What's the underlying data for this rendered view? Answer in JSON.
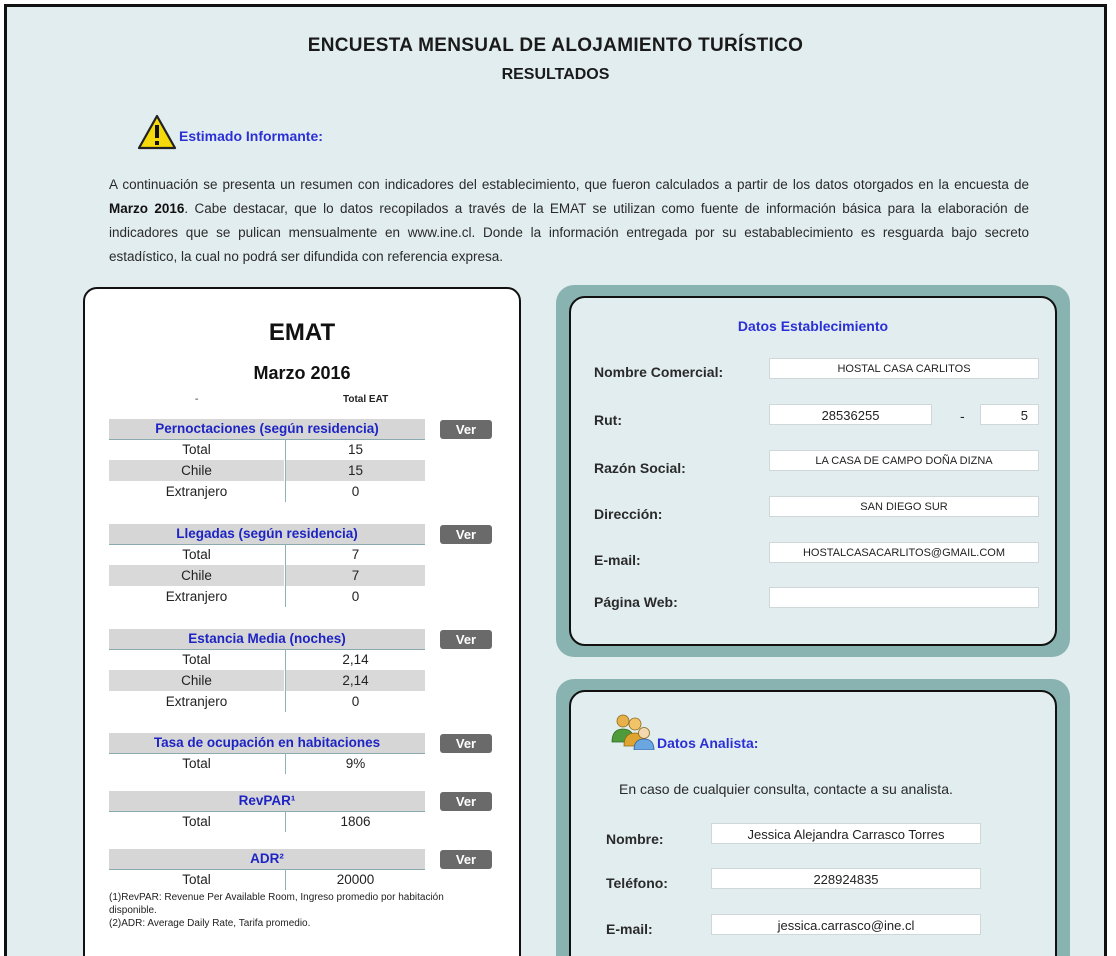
{
  "header": {
    "title": "ENCUESTA MENSUAL DE ALOJAMIENTO TURÍSTICO",
    "subtitle": "RESULTADOS"
  },
  "notice": {
    "icon": "warning-icon",
    "label": "Estimado Informante:",
    "text_before": "A continuación se presenta un resumen con indicadores del establecimiento, que fueron calculados a partir de los datos otorgados en la encuesta de ",
    "text_bold": "Marzo 2016",
    "text_after": ". Cabe destacar, que lo datos recopilados a través de la EMAT se utilizan como fuente de información básica para la elaboración de indicadores que se pulican mensualmente en www.ine.cl. Donde la información entregada por su estabablecimiento es resguarda bajo secreto estadístico, la cual no podrá ser difundida con referencia expresa."
  },
  "emat": {
    "title": "EMAT",
    "period": "Marzo 2016",
    "col_label": "-",
    "col_total": "Total EAT",
    "ver_label": "Ver",
    "sections": [
      {
        "title": "Pernoctaciones (según residencia)",
        "rows": [
          {
            "label": "Total",
            "value": "15"
          },
          {
            "label": "Chile",
            "value": "15"
          },
          {
            "label": "Extranjero",
            "value": "0"
          }
        ]
      },
      {
        "title": "Llegadas (según residencia)",
        "rows": [
          {
            "label": "Total",
            "value": "7"
          },
          {
            "label": "Chile",
            "value": "7"
          },
          {
            "label": "Extranjero",
            "value": "0"
          }
        ]
      },
      {
        "title": "Estancia Media (noches)",
        "rows": [
          {
            "label": "Total",
            "value": "2,14"
          },
          {
            "label": "Chile",
            "value": "2,14"
          },
          {
            "label": "Extranjero",
            "value": "0"
          }
        ]
      },
      {
        "title": "Tasa de ocupación en habitaciones",
        "rows": [
          {
            "label": "Total",
            "value": "9%"
          }
        ]
      },
      {
        "title": "RevPAR¹",
        "rows": [
          {
            "label": "Total",
            "value": "1806"
          }
        ]
      },
      {
        "title": "ADR²",
        "rows": [
          {
            "label": "Total",
            "value": "20000"
          }
        ]
      }
    ],
    "footnote1": "(1)RevPAR: Revenue Per Available Room, Ingreso promedio por habitación disponible.",
    "footnote2": "(2)ADR: Average Daily Rate, Tarifa promedio."
  },
  "establecimiento": {
    "title": "Datos Establecimiento",
    "nombre_label": "Nombre Comercial:",
    "nombre_value": "HOSTAL CASA CARLITOS",
    "rut_label": "Rut:",
    "rut_value": "28536255",
    "rut_sep": "-",
    "rut_dv": "5",
    "razon_label": "Razón Social:",
    "razon_value": "LA CASA DE CAMPO DOÑA DIZNA",
    "direccion_label": "Dirección:",
    "direccion_value": "SAN DIEGO SUR",
    "email_label": "E-mail:",
    "email_value": "HOSTALCASACARLITOS@GMAIL.COM",
    "web_label": "Página Web:",
    "web_value": ""
  },
  "analista": {
    "icon": "users-icon",
    "title": "Datos Analista:",
    "note": "En caso de cualquier consulta, contacte a su analista.",
    "nombre_label": "Nombre:",
    "nombre_value": "Jessica Alejandra Carrasco Torres",
    "telefono_label": "Teléfono:",
    "telefono_value": "228924835",
    "email_label": "E-mail:",
    "email_value": "jessica.carrasco@ine.cl"
  },
  "colors": {
    "background": "#e2edef",
    "link_blue": "#2b30d6",
    "section_title_blue": "#1e24c4",
    "panel_border_teal": "#89b3b1",
    "button_gray": "#6a6a6a"
  }
}
